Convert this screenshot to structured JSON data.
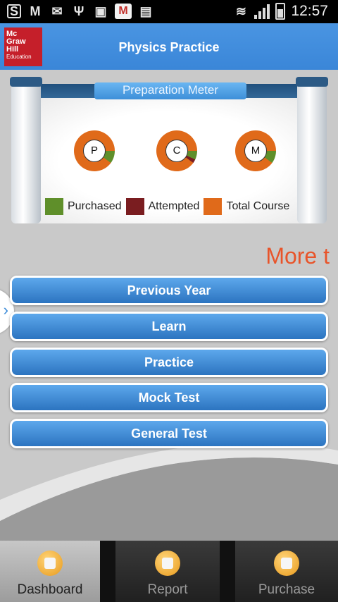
{
  "app": {
    "title": "Physics Practice",
    "logo_lines": [
      "Mc",
      "Graw",
      "Hill",
      "Education"
    ]
  },
  "status_bar": {
    "time": "12:57",
    "icons": [
      "skype-icon",
      "gmail-icon",
      "mail-icon",
      "usb-icon",
      "image-icon",
      "gmail-icon",
      "briefcase-icon",
      "wifi-icon",
      "signal-icon",
      "battery-icon"
    ]
  },
  "meter": {
    "label": "Preparation Meter",
    "donuts": [
      {
        "letter": "P",
        "purchased": 0.1,
        "attempted": 0.0
      },
      {
        "letter": "C",
        "purchased": 0.07,
        "attempted": 0.03
      },
      {
        "letter": "M",
        "purchased": 0.1,
        "attempted": 0.0
      }
    ],
    "legend": [
      {
        "label": "Purchased",
        "color": "#5f8f2a"
      },
      {
        "label": "Attempted",
        "color": "#7a1d20"
      },
      {
        "label": "Total Course",
        "color": "#e06a1a"
      }
    ]
  },
  "more_text": "More t",
  "menu": [
    {
      "label": "Previous Year"
    },
    {
      "label": "Learn"
    },
    {
      "label": "Practice"
    },
    {
      "label": "Mock Test"
    },
    {
      "label": "General Test"
    }
  ],
  "tabs": [
    {
      "label": "Dashboard",
      "active": true
    },
    {
      "label": "Report",
      "active": false
    },
    {
      "label": "Purchase",
      "active": false
    }
  ]
}
